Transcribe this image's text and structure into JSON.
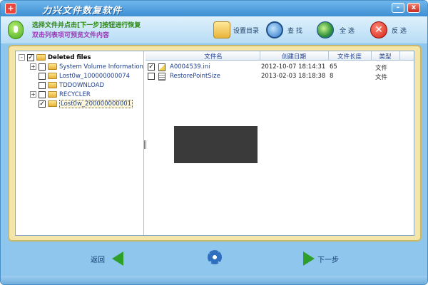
{
  "window": {
    "title": "力兴文件数复软件",
    "minimize_label": "-",
    "close_label": "x"
  },
  "toolbar": {
    "instruction_line1": "选择文件并点击[下一步]按钮进行恢复",
    "instruction_line2": "双击列表项可预览文件内容",
    "buttons": [
      {
        "label": "设置目录",
        "icon": "folder-settings-icon"
      },
      {
        "label": "查 找",
        "icon": "search-icon"
      },
      {
        "label": "全 选",
        "icon": "globe-icon"
      },
      {
        "label": "反 选",
        "icon": "cancel-icon"
      }
    ]
  },
  "tree": {
    "root": {
      "label": "Deleted files",
      "checked": true,
      "expander": "-"
    },
    "items": [
      {
        "label": "System Volume Information",
        "expander": "+",
        "checked": false,
        "selected": false
      },
      {
        "label": "Lost0w_100000000074",
        "expander": "",
        "checked": false,
        "selected": false
      },
      {
        "label": "TDDOWNLOAD",
        "expander": "",
        "checked": false,
        "selected": false
      },
      {
        "label": "RECYCLER",
        "expander": "+",
        "checked": false,
        "selected": false
      },
      {
        "label": "Lost0w_200000000001",
        "expander": "",
        "checked": true,
        "selected": true
      }
    ]
  },
  "file_list": {
    "columns": [
      "文件名",
      "创建日期",
      "文件长度",
      "类型"
    ],
    "rows": [
      {
        "checked": true,
        "icon": "ini-file-icon",
        "name": "A0004539.ini",
        "date": "2012-10-07 18:14:31",
        "size": "65",
        "type": "文件"
      },
      {
        "checked": false,
        "icon": "system-file-icon",
        "name": "RestorePointSize",
        "date": "2013-02-03 18:18:38",
        "size": "8",
        "type": "文件"
      }
    ]
  },
  "bottom": {
    "back_label": "返回",
    "next_label": "下一步"
  },
  "colors": {
    "window_bg": "#8ec6ee",
    "panel_bg": "#f3e6a8",
    "accent_green": "#2ea02a"
  }
}
